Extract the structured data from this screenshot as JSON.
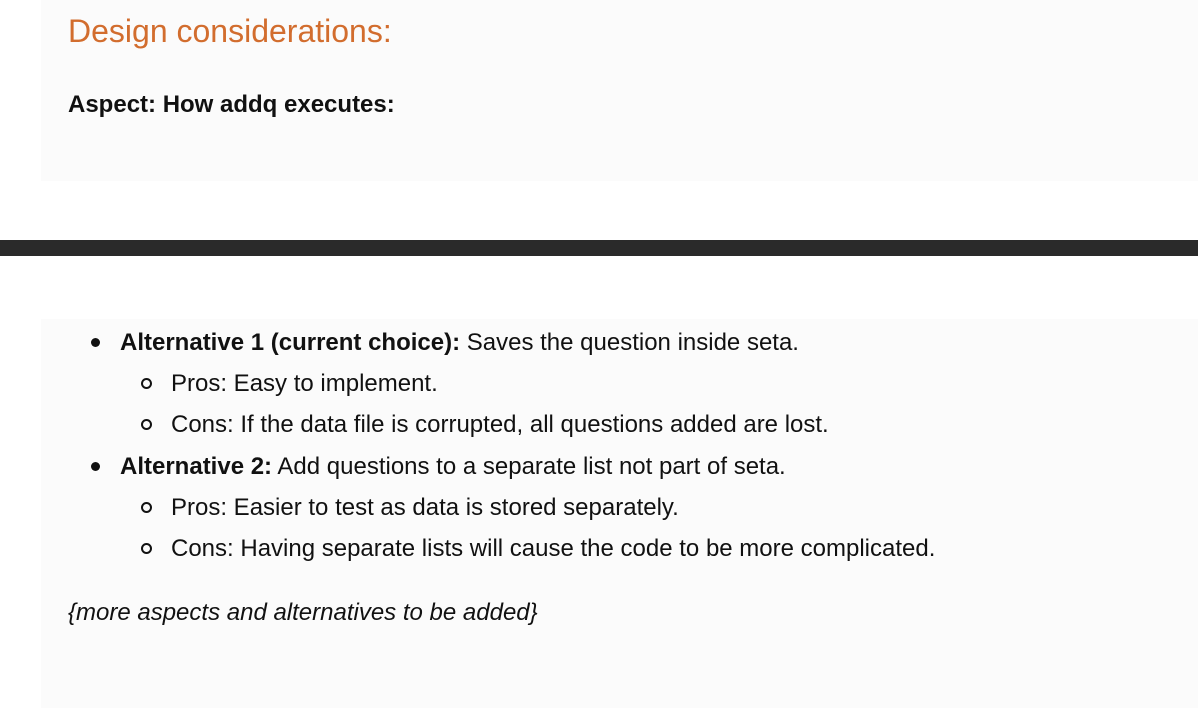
{
  "colors": {
    "heading": "#d26d2e",
    "panel_background": "#fbfbfb",
    "divider": "#2a2a2a",
    "text": "#111111"
  },
  "design": {
    "heading": "Design considerations:",
    "aspect": "Aspect: How addq executes:"
  },
  "alternatives": [
    {
      "title": "Alternative 1 (current choice):",
      "text": " Saves the question inside seta.",
      "sub": [
        "Pros: Easy to implement.",
        "Cons: If the data file is corrupted, all questions added are lost."
      ]
    },
    {
      "title": "Alternative 2:",
      "text": " Add questions to a separate list not part of seta.",
      "sub": [
        "Pros: Easier to test as data is stored separately.",
        "Cons: Having separate lists will cause the code to be more complicated."
      ]
    }
  ],
  "note": "{more aspects and alternatives to be added}"
}
